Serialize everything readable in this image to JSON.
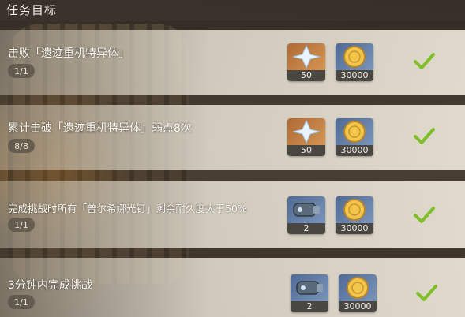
{
  "header": {
    "title": "任务目标"
  },
  "tasks": [
    {
      "title": "击败「遗迹重机特异体」",
      "progress": "1/1",
      "rewards": [
        {
          "icon": "primogem-icon",
          "qty": "50"
        },
        {
          "icon": "mora-icon",
          "qty": "30000"
        }
      ],
      "completed": true
    },
    {
      "title": "累计击破「遗迹重机特异体」弱点8次",
      "progress": "8/8",
      "rewards": [
        {
          "icon": "primogem-icon",
          "qty": "50"
        },
        {
          "icon": "mora-icon",
          "qty": "30000"
        }
      ],
      "completed": true
    },
    {
      "title": "完成挑战时所有「普尔希娜光钉」剩余耐久度大于50%",
      "progress": "1/1",
      "rewards": [
        {
          "icon": "cannon-item-icon",
          "qty": "2"
        },
        {
          "icon": "mora-icon",
          "qty": "30000"
        }
      ],
      "completed": true
    },
    {
      "title": "3分钟内完成挑战",
      "progress": "1/1",
      "rewards": [
        {
          "icon": "cannon-item-icon",
          "qty": "2"
        },
        {
          "icon": "mora-icon",
          "qty": "30000"
        }
      ],
      "completed": true
    }
  ],
  "colors": {
    "check": "#7fbf2a",
    "mora": "#f2c64a",
    "primogem": "#e9f4ff"
  }
}
